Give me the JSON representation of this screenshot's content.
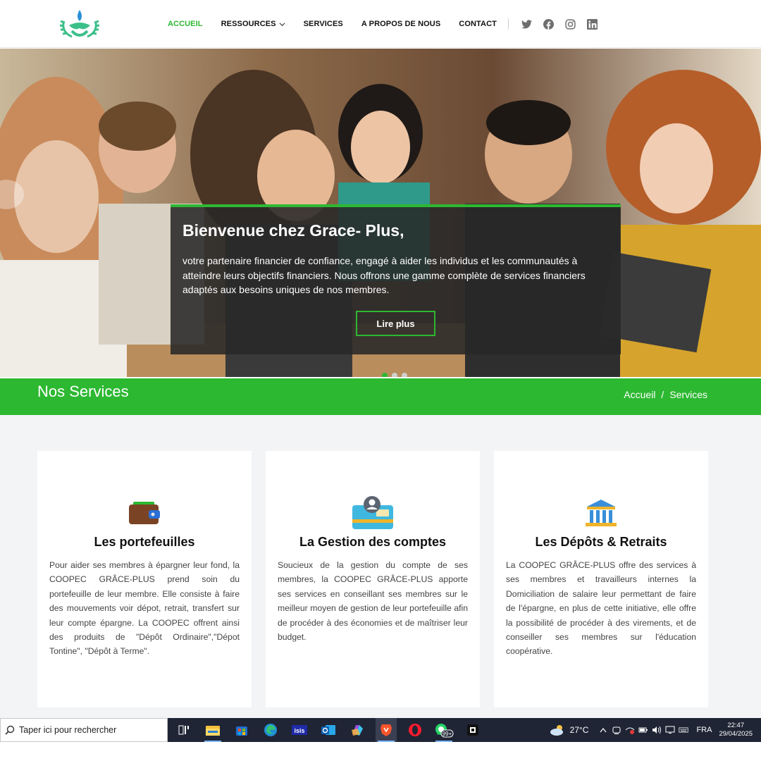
{
  "nav": {
    "items": [
      {
        "label": "ACCUEIL",
        "active": true
      },
      {
        "label": "RESSOURCES",
        "dropdown": true
      },
      {
        "label": "SERVICES"
      },
      {
        "label": "A PROPOS DE NOUS"
      },
      {
        "label": "CONTACT"
      }
    ],
    "social": [
      "twitter-icon",
      "facebook-icon",
      "instagram-icon",
      "linkedin-icon"
    ]
  },
  "hero": {
    "title": "Bienvenue chez Grace- Plus,",
    "text": "votre partenaire financier de confiance, engagé à aider les individus et les communautés à atteindre leurs objectifs financiers. Nous offrons une gamme complète de services financiers adaptés aux besoins uniques de nos membres.",
    "button": "Lire plus",
    "slides": 3,
    "active_slide": 1
  },
  "banner": {
    "title": "Nos Services",
    "breadcrumb": {
      "home": "Accueil",
      "separator": "/",
      "current": "Services"
    }
  },
  "services": [
    {
      "icon": "wallet-icon",
      "title": "Les portefeuilles",
      "text": "Pour aider ses membres à épargner leur fond, la COOPEC GRÂCE-PLUS prend soin du portefeuille de leur membre. Elle consiste à faire des mouvements voir dépot, retrait, transfert sur leur compte épargne. La COOPEC offrent ainsi des produits de \"Dépôt Ordinaire\",\"Dépot Tontine\", \"Dépôt à Terme\"."
    },
    {
      "icon": "account-card-icon",
      "title": "La Gestion des comptes",
      "text": "Soucieux de la gestion du compte de ses membres, la COOPEC GRÂCE-PLUS apporte ses services en conseillant ses membres sur le meilleur moyen de gestion de leur portefeuille afin de procéder à des économies et de maîtriser leur budget."
    },
    {
      "icon": "bank-icon",
      "title": "Les Dépôts & Retraits",
      "text": "La COOPEC GRÂCE-PLUS offre des services à ses membres et travailleurs internes la Domiciliation de salaire leur permettant de faire de l'épargne, en plus de cette initiative, elle offre la possibilité de procéder à des virements, et de conseiller ses membres sur l'éducation coopérative."
    }
  ],
  "taskbar": {
    "search_placeholder": "Taper ici pour rechercher",
    "apps": [
      "task-view-icon",
      "file-explorer-icon",
      "store-icon",
      "edge-icon",
      "isis-icon",
      "outlook-icon",
      "m365-icon",
      "brave-icon",
      "opera-icon",
      "whatsapp-icon",
      "app-icon"
    ],
    "whatsapp_badge": "99+",
    "weather": "27°C",
    "language": "FRA",
    "time": "22:47",
    "date": "29/04/2025"
  },
  "colors": {
    "accent": "#2db832",
    "taskbar": "#1f2535",
    "section_bg": "#f3f4f6"
  }
}
